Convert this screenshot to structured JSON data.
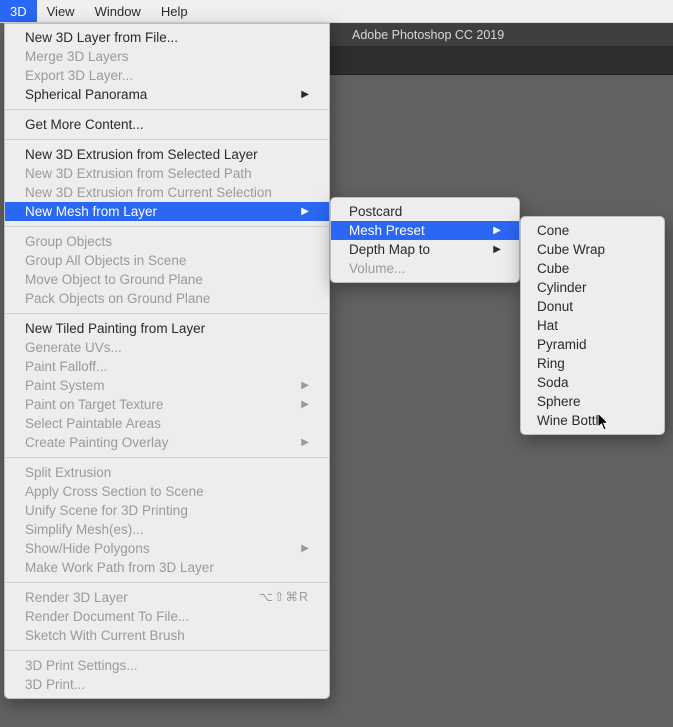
{
  "menubar": {
    "items": [
      {
        "label": "3D",
        "active": true
      },
      {
        "label": "View",
        "active": false
      },
      {
        "label": "Window",
        "active": false
      },
      {
        "label": "Help",
        "active": false
      }
    ]
  },
  "titlebar": {
    "app_name": "Adobe Photoshop CC 2019"
  },
  "menu1": [
    {
      "type": "item",
      "label": "New 3D Layer from File...",
      "enabled": true
    },
    {
      "type": "item",
      "label": "Merge 3D Layers",
      "enabled": false
    },
    {
      "type": "item",
      "label": "Export 3D Layer...",
      "enabled": false
    },
    {
      "type": "item",
      "label": "Spherical Panorama",
      "enabled": true,
      "submenu": true
    },
    {
      "type": "sep"
    },
    {
      "type": "item",
      "label": "Get More Content...",
      "enabled": true
    },
    {
      "type": "sep"
    },
    {
      "type": "item",
      "label": "New 3D Extrusion from Selected Layer",
      "enabled": true
    },
    {
      "type": "item",
      "label": "New 3D Extrusion from Selected Path",
      "enabled": false
    },
    {
      "type": "item",
      "label": "New 3D Extrusion from Current Selection",
      "enabled": false
    },
    {
      "type": "item",
      "label": "New Mesh from Layer",
      "enabled": true,
      "submenu": true,
      "highlight": true
    },
    {
      "type": "sep"
    },
    {
      "type": "item",
      "label": "Group Objects",
      "enabled": false
    },
    {
      "type": "item",
      "label": "Group All Objects in Scene",
      "enabled": false
    },
    {
      "type": "item",
      "label": "Move Object to Ground Plane",
      "enabled": false
    },
    {
      "type": "item",
      "label": "Pack Objects on Ground Plane",
      "enabled": false
    },
    {
      "type": "sep"
    },
    {
      "type": "item",
      "label": "New Tiled Painting from Layer",
      "enabled": true
    },
    {
      "type": "item",
      "label": "Generate UVs...",
      "enabled": false
    },
    {
      "type": "item",
      "label": "Paint Falloff...",
      "enabled": false
    },
    {
      "type": "item",
      "label": "Paint System",
      "enabled": false,
      "submenu": true
    },
    {
      "type": "item",
      "label": "Paint on Target Texture",
      "enabled": false,
      "submenu": true
    },
    {
      "type": "item",
      "label": "Select Paintable Areas",
      "enabled": false
    },
    {
      "type": "item",
      "label": "Create Painting Overlay",
      "enabled": false,
      "submenu": true
    },
    {
      "type": "sep"
    },
    {
      "type": "item",
      "label": "Split Extrusion",
      "enabled": false
    },
    {
      "type": "item",
      "label": "Apply Cross Section to Scene",
      "enabled": false
    },
    {
      "type": "item",
      "label": "Unify Scene for 3D Printing",
      "enabled": false
    },
    {
      "type": "item",
      "label": "Simplify Mesh(es)...",
      "enabled": false
    },
    {
      "type": "item",
      "label": "Show/Hide Polygons",
      "enabled": false,
      "submenu": true
    },
    {
      "type": "item",
      "label": "Make Work Path from 3D Layer",
      "enabled": false
    },
    {
      "type": "sep"
    },
    {
      "type": "item",
      "label": "Render 3D Layer",
      "enabled": false,
      "shortcut": "⌥⇧⌘R"
    },
    {
      "type": "item",
      "label": "Render Document To File...",
      "enabled": false
    },
    {
      "type": "item",
      "label": "Sketch With Current Brush",
      "enabled": false
    },
    {
      "type": "sep"
    },
    {
      "type": "item",
      "label": "3D Print Settings...",
      "enabled": false
    },
    {
      "type": "item",
      "label": "3D Print...",
      "enabled": false
    }
  ],
  "menu2": [
    {
      "label": "Postcard",
      "enabled": true
    },
    {
      "label": "Mesh Preset",
      "enabled": true,
      "submenu": true,
      "highlight": true
    },
    {
      "label": "Depth Map to",
      "enabled": true,
      "submenu": true
    },
    {
      "label": "Volume...",
      "enabled": false
    }
  ],
  "menu3": [
    {
      "label": "Cone"
    },
    {
      "label": "Cube Wrap"
    },
    {
      "label": "Cube"
    },
    {
      "label": "Cylinder"
    },
    {
      "label": "Donut"
    },
    {
      "label": "Hat"
    },
    {
      "label": "Pyramid"
    },
    {
      "label": "Ring"
    },
    {
      "label": "Soda"
    },
    {
      "label": "Sphere"
    },
    {
      "label": "Wine Bottle"
    }
  ]
}
